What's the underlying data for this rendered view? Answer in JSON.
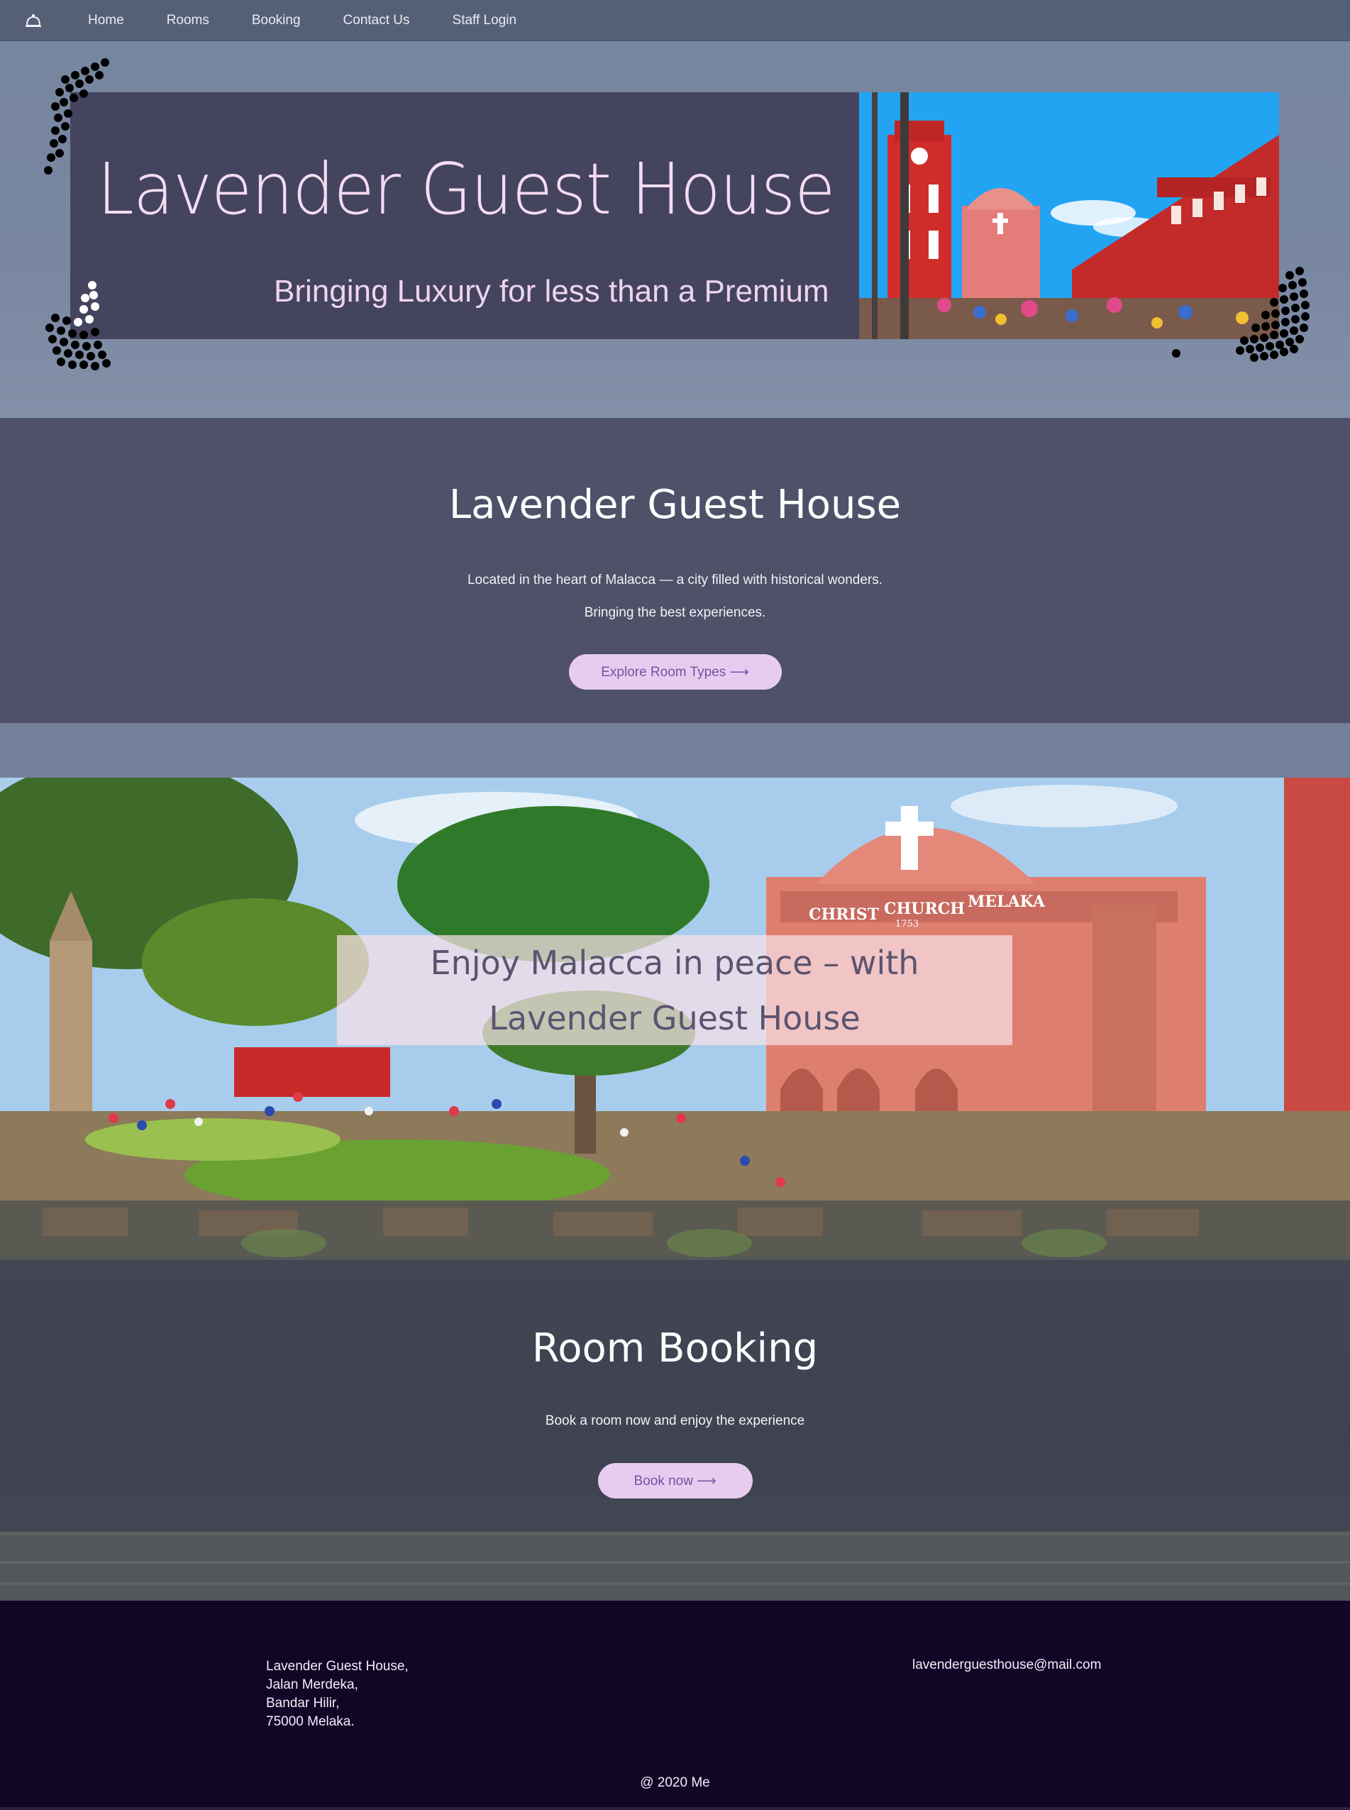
{
  "nav": {
    "logo_icon": "hotel-bell-icon",
    "items": [
      {
        "label": "Home"
      },
      {
        "label": "Rooms"
      },
      {
        "label": "Booking"
      },
      {
        "label": "Contact Us"
      },
      {
        "label": "Staff Login"
      }
    ]
  },
  "hero": {
    "title": "Lavender Guest House",
    "subtitle": "Bringing Luxury for less than a Premium"
  },
  "intro": {
    "heading": "Lavender Guest House",
    "line1": "Located in the heart of Malacca — a city filled with historical wonders.",
    "line2": "Bringing the best experiences.",
    "button_label": "Explore Room Types ⟶"
  },
  "panorama": {
    "caption_line1": "Enjoy Malacca in peace – with",
    "caption_line2": "Lavender Guest House",
    "sign_words": [
      "CHRIST",
      "CHURCH",
      "MELAKA"
    ],
    "sign_year": "1753"
  },
  "booking": {
    "heading": "Room Booking",
    "text": "Book a room now and enjoy the experience",
    "button_label": "Book now ⟶"
  },
  "footer": {
    "address": [
      "Lavender Guest House,",
      "Jalan Merdeka,",
      "Bandar Hilir,",
      "75000 Melaka."
    ],
    "email": "lavenderguesthouse@mail.com",
    "copyright": "@ 2020 Me"
  },
  "colors": {
    "nav_bg": "#556077",
    "hero_banner": "#45445e",
    "title_pink": "#f4dcf3",
    "section_dark": "#4e5168",
    "button_bg": "#e6cdf0",
    "button_text": "#7b4ea3",
    "footer_bg": "#120627"
  }
}
